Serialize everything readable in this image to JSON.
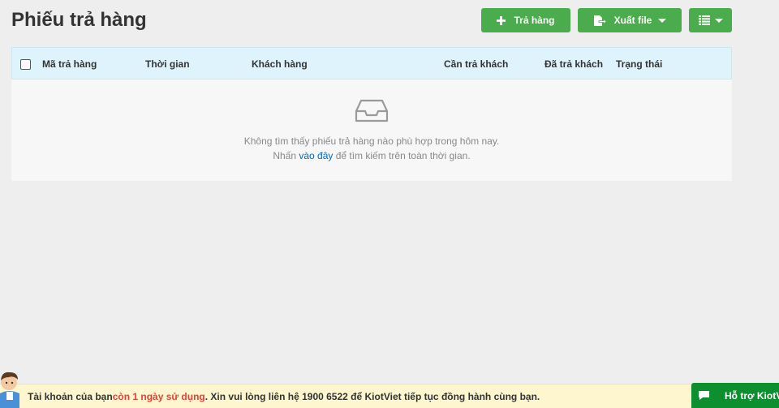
{
  "page": {
    "title": "Phiếu trả hàng"
  },
  "toolbar": {
    "return_label": "Trả hàng",
    "export_label": "Xuất file",
    "colors": {
      "button": "#4bac4d",
      "header": "#dff3fc"
    }
  },
  "grid": {
    "columns": [
      "Mã trả hàng",
      "Thời gian",
      "Khách hàng",
      "Cần trả khách",
      "Đã trả khách",
      "Trạng thái"
    ],
    "empty": {
      "line1": "Không tìm thấy phiếu trả hàng nào phù hợp trong hôm nay.",
      "line2_prefix": "Nhấn ",
      "line2_link": "vào đây",
      "line2_suffix": " để tìm kiếm trên toàn thời gian."
    }
  },
  "notice": {
    "prefix": "Tài khoản của bạn ",
    "highlight": "còn 1 ngày sử dụng",
    "suffix": ". Xin vui lòng liên hệ 1900 6522 để KiotViet tiếp tục đồng hành cùng bạn.",
    "highlight_color": "#e3403a"
  },
  "support": {
    "label": "Hỗ trợ KiotViet"
  }
}
